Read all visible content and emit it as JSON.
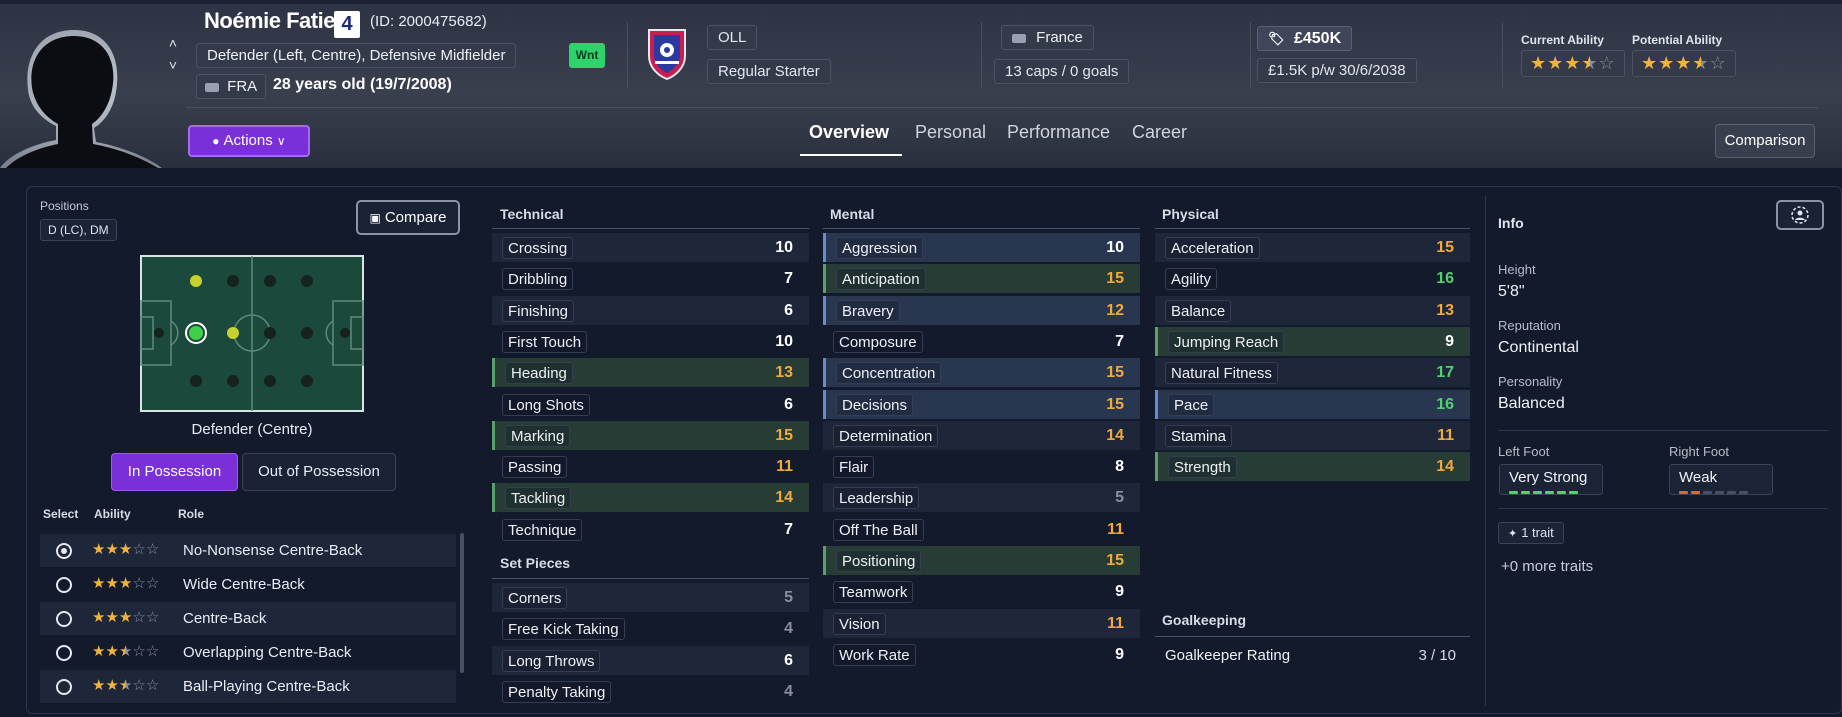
{
  "player": {
    "name": "Noémie Fatier",
    "number": "4",
    "id_text": "(ID: 2000475682)",
    "positions": "Defender (Left, Centre), Defensive Midfielder",
    "nationality_code": "FRA",
    "age": "28 years old (19/7/2008)",
    "status_badge": "Wnt"
  },
  "club": {
    "name": "OLL",
    "role": "Regular Starter"
  },
  "international": {
    "country": "France",
    "caps": "13 caps / 0 goals"
  },
  "contract": {
    "value": "£450K",
    "wage": "£1.5K p/w",
    "expires": "30/6/2038"
  },
  "ability": {
    "current_label": "Current Ability",
    "current_stars": 3.5,
    "potential_label": "Potential Ability",
    "potential_stars": 3.5,
    "star_color": "#f0b43c"
  },
  "toolbar": {
    "actions_label": "Actions",
    "comparison_label": "Comparison"
  },
  "tabs": [
    {
      "label": "Overview",
      "active": true
    },
    {
      "label": "Personal",
      "active": false
    },
    {
      "label": "Performance",
      "active": false
    },
    {
      "label": "Career",
      "active": false
    }
  ],
  "positions_panel": {
    "label": "Positions",
    "short": "D (LC), DM",
    "compare_label": "Compare",
    "caption": "Defender (Centre)",
    "in_possession": "In Possession",
    "out_of_possession": "Out of Possession",
    "col_select": "Select",
    "col_ability": "Ability",
    "col_role": "Role",
    "roles": [
      {
        "name": "No-Nonsense Centre-Back",
        "stars": 3,
        "selected": true
      },
      {
        "name": "Wide Centre-Back",
        "stars": 3,
        "selected": false
      },
      {
        "name": "Centre-Back",
        "stars": 3,
        "selected": false
      },
      {
        "name": "Overlapping Centre-Back",
        "stars": 2.5,
        "selected": false
      },
      {
        "name": "Ball-Playing Centre-Back",
        "stars": 2.5,
        "selected": false
      }
    ]
  },
  "technical": {
    "title": "Technical",
    "attrs": [
      {
        "name": "Crossing",
        "value": "10"
      },
      {
        "name": "Dribbling",
        "value": "7"
      },
      {
        "name": "Finishing",
        "value": "6"
      },
      {
        "name": "First Touch",
        "value": "10"
      },
      {
        "name": "Heading",
        "value": "13"
      },
      {
        "name": "Long Shots",
        "value": "6"
      },
      {
        "name": "Marking",
        "value": "15"
      },
      {
        "name": "Passing",
        "value": "11"
      },
      {
        "name": "Tackling",
        "value": "14"
      },
      {
        "name": "Technique",
        "value": "7"
      }
    ]
  },
  "set_pieces": {
    "title": "Set Pieces",
    "attrs": [
      {
        "name": "Corners",
        "value": "5"
      },
      {
        "name": "Free Kick Taking",
        "value": "4"
      },
      {
        "name": "Long Throws",
        "value": "6"
      },
      {
        "name": "Penalty Taking",
        "value": "4"
      }
    ]
  },
  "mental": {
    "title": "Mental",
    "attrs": [
      {
        "name": "Aggression",
        "value": "10"
      },
      {
        "name": "Anticipation",
        "value": "15"
      },
      {
        "name": "Bravery",
        "value": "12"
      },
      {
        "name": "Composure",
        "value": "7"
      },
      {
        "name": "Concentration",
        "value": "15"
      },
      {
        "name": "Decisions",
        "value": "15"
      },
      {
        "name": "Determination",
        "value": "14"
      },
      {
        "name": "Flair",
        "value": "8"
      },
      {
        "name": "Leadership",
        "value": "5"
      },
      {
        "name": "Off The Ball",
        "value": "11"
      },
      {
        "name": "Positioning",
        "value": "15"
      },
      {
        "name": "Teamwork",
        "value": "9"
      },
      {
        "name": "Vision",
        "value": "11"
      },
      {
        "name": "Work Rate",
        "value": "9"
      }
    ]
  },
  "physical": {
    "title": "Physical",
    "attrs": [
      {
        "name": "Acceleration",
        "value": "15"
      },
      {
        "name": "Agility",
        "value": "16"
      },
      {
        "name": "Balance",
        "value": "13"
      },
      {
        "name": "Jumping Reach",
        "value": "9"
      },
      {
        "name": "Natural Fitness",
        "value": "17"
      },
      {
        "name": "Pace",
        "value": "16"
      },
      {
        "name": "Stamina",
        "value": "11"
      },
      {
        "name": "Strength",
        "value": "14"
      }
    ]
  },
  "goalkeeping": {
    "title": "Goalkeeping",
    "rating_label": "Goalkeeper Rating",
    "rating_value": "3 / 10"
  },
  "info": {
    "title": "Info",
    "height_label": "Height",
    "height": "5'8\"",
    "reputation_label": "Reputation",
    "reputation": "Continental",
    "personality_label": "Personality",
    "personality": "Balanced",
    "left_foot_label": "Left Foot",
    "left_foot": "Very Strong",
    "left_foot_level": 6,
    "right_foot_label": "Right Foot",
    "right_foot": "Weak",
    "right_foot_level": 2,
    "traits": "1 trait",
    "more_traits": "+0 more traits"
  },
  "colors": {
    "accent": "#7b2fd8",
    "value_high": "#4fd26a",
    "value_mid": "#f0a93a",
    "value_low": "#8a8f9c",
    "foot_strong": "#4fd26a",
    "foot_weak": "#e0662a"
  }
}
